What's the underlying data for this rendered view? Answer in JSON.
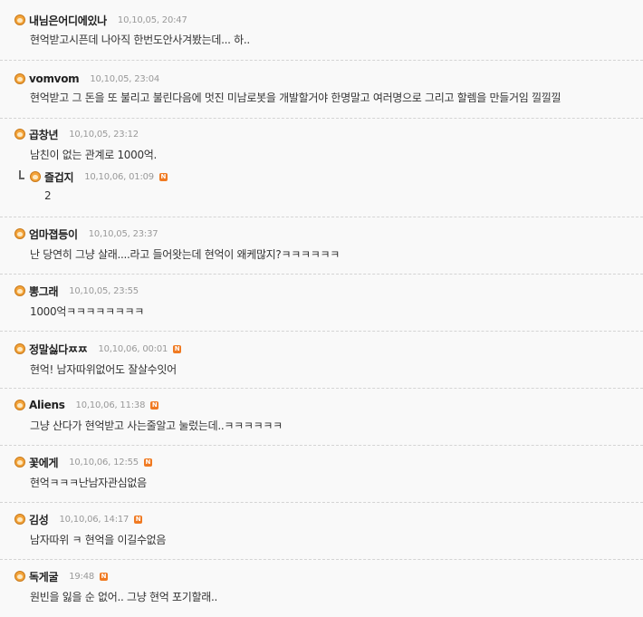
{
  "comments": [
    {
      "author": "내님은어디에있나",
      "date": "10,10,05, 20:47",
      "new": false,
      "text": "현억받고시픈데 나아직 한번도안사겨봤는데... 하.."
    },
    {
      "author": "vomvom",
      "date": "10,10,05, 23:04",
      "new": false,
      "text": "현억받고 그 돈을 또 불리고 불린다음에 멋진 미남로봇을 개발할거야 한명말고 여러명으로 그리고 할렘을 만들거임 낄낄낄"
    },
    {
      "author": "곱창년",
      "date": "10,10,05, 23:12",
      "new": false,
      "text": "남친이 없는 관계로 1000억.",
      "reply": {
        "author": "즐겁지",
        "date": "10,10,06, 01:09",
        "new": true,
        "text": "2"
      }
    },
    {
      "author": "엄마졉등이",
      "date": "10,10,05, 23:37",
      "new": false,
      "text": "난 당연히 그냥 살래....라고 들어왓는데 현억이 왜케많지?ㅋㅋㅋㅋㅋㅋ"
    },
    {
      "author": "뽕그래",
      "date": "10,10,05, 23:55",
      "new": false,
      "text": "1000억ㅋㅋㅋㅋㅋㅋㅋㅋ"
    },
    {
      "author": "정말싫다ㅉㅉ",
      "date": "10,10,06, 00:01",
      "new": true,
      "text": "현억! 남자따위없어도 잘살수잇어"
    },
    {
      "author": "Aliens",
      "date": "10,10,06, 11:38",
      "new": true,
      "text": "그냥 산다가 현억받고 사는줄알고 눌렀는데..ㅋㅋㅋㅋㅋㅋ"
    },
    {
      "author": "꽃에게",
      "date": "10,10,06, 12:55",
      "new": true,
      "text": "현억ㅋㅋㅋ난남자관심없음"
    },
    {
      "author": "김성",
      "date": "10,10,06, 14:17",
      "new": true,
      "text": "남자따위 ㅋ 현억을 이길수없음"
    },
    {
      "author": "독게굴",
      "date": "19:48",
      "new": true,
      "text": "원빈을 잃을 순 없어.. 그냥 현억 포기할래.."
    }
  ],
  "badge_label": "N",
  "accent": "#f07a22"
}
